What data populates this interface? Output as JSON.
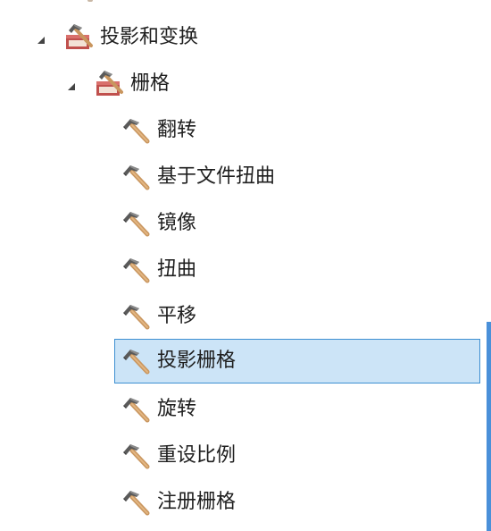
{
  "tree": {
    "toolset": {
      "label": "投影和变换",
      "expanded": true,
      "icon": "toolbox-icon"
    },
    "subset": {
      "label": "栅格",
      "expanded": true,
      "icon": "toolbox-icon"
    },
    "tools": [
      {
        "label": "翻转",
        "icon": "hammer-icon",
        "selected": false
      },
      {
        "label": "基于文件扭曲",
        "icon": "hammer-icon",
        "selected": false
      },
      {
        "label": "镜像",
        "icon": "hammer-icon",
        "selected": false
      },
      {
        "label": "扭曲",
        "icon": "hammer-icon",
        "selected": false
      },
      {
        "label": "平移",
        "icon": "hammer-icon",
        "selected": false
      },
      {
        "label": "投影栅格",
        "icon": "hammer-icon",
        "selected": true
      },
      {
        "label": "旋转",
        "icon": "hammer-icon",
        "selected": false
      },
      {
        "label": "重设比例",
        "icon": "hammer-icon",
        "selected": false
      },
      {
        "label": "注册栅格",
        "icon": "hammer-icon",
        "selected": false
      }
    ]
  },
  "colors": {
    "selection_bg": "#cce4f7",
    "selection_border": "#3d8fd1",
    "scrollbar": "#4a90d9"
  }
}
